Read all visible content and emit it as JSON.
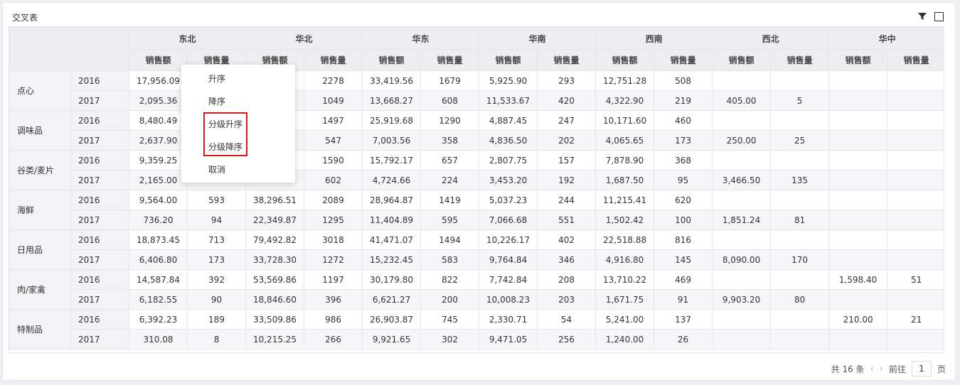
{
  "panel_title": "交叉表",
  "icons": {
    "filter": "filter-icon",
    "maximize": "square-icon"
  },
  "regions": [
    "东北",
    "华北",
    "华东",
    "华南",
    "西南",
    "西北",
    "华中"
  ],
  "measures": {
    "amount": "销售额",
    "qty": "销售量"
  },
  "rows": [
    {
      "product": "点心",
      "years": [
        {
          "year": "2016",
          "cells": [
            "17,956.09",
            "",
            "",
            "2278",
            "33,419.56",
            "1679",
            "5,925.90",
            "293",
            "12,751.28",
            "508",
            "",
            "",
            "",
            ""
          ]
        },
        {
          "year": "2017",
          "cells": [
            "2,095.36",
            "",
            "",
            "1049",
            "13,668.27",
            "608",
            "11,533.67",
            "420",
            "4,322.90",
            "219",
            "405.00",
            "5",
            "",
            ""
          ]
        }
      ]
    },
    {
      "product": "调味品",
      "years": [
        {
          "year": "2016",
          "cells": [
            "8,480.49",
            "",
            "",
            "1497",
            "25,919.68",
            "1290",
            "4,887.45",
            "247",
            "10,171.60",
            "460",
            "",
            "",
            "",
            ""
          ]
        },
        {
          "year": "2017",
          "cells": [
            "2,637.90",
            "",
            "",
            "547",
            "7,003.56",
            "358",
            "4,836.50",
            "202",
            "4,065.65",
            "173",
            "250.00",
            "25",
            "",
            ""
          ]
        }
      ]
    },
    {
      "product": "谷类/麦片",
      "years": [
        {
          "year": "2016",
          "cells": [
            "9,359.25",
            "",
            "",
            "1590",
            "15,792.17",
            "657",
            "2,807.75",
            "157",
            "7,878.90",
            "368",
            "",
            "",
            "",
            ""
          ]
        },
        {
          "year": "2017",
          "cells": [
            "2,165.00",
            "",
            "",
            "602",
            "4,724.66",
            "224",
            "3,453.20",
            "192",
            "1,687.50",
            "95",
            "3,466.50",
            "135",
            "",
            ""
          ]
        }
      ]
    },
    {
      "product": "海鲜",
      "years": [
        {
          "year": "2016",
          "cells": [
            "9,564.00",
            "593",
            "38,296.51",
            "2089",
            "28,964.87",
            "1419",
            "5,037.23",
            "244",
            "11,215.41",
            "620",
            "",
            "",
            "",
            ""
          ]
        },
        {
          "year": "2017",
          "cells": [
            "736.20",
            "94",
            "22,349.87",
            "1295",
            "11,404.89",
            "595",
            "7,066.68",
            "551",
            "1,502.42",
            "100",
            "1,851.24",
            "81",
            "",
            ""
          ]
        }
      ]
    },
    {
      "product": "日用品",
      "years": [
        {
          "year": "2016",
          "cells": [
            "18,873.45",
            "713",
            "79,492.82",
            "3018",
            "41,471.07",
            "1494",
            "10,226.17",
            "402",
            "22,518.88",
            "816",
            "",
            "",
            "",
            ""
          ]
        },
        {
          "year": "2017",
          "cells": [
            "6,406.80",
            "173",
            "33,728.30",
            "1272",
            "15,232.45",
            "583",
            "9,764.84",
            "346",
            "4,916.80",
            "145",
            "8,090.00",
            "170",
            "",
            ""
          ]
        }
      ]
    },
    {
      "product": "肉/家禽",
      "years": [
        {
          "year": "2016",
          "cells": [
            "14,587.84",
            "392",
            "53,569.86",
            "1197",
            "30,179.80",
            "822",
            "7,742.84",
            "208",
            "13,710.22",
            "469",
            "",
            "",
            "1,598.40",
            "51"
          ]
        },
        {
          "year": "2017",
          "cells": [
            "6,182.55",
            "90",
            "18,846.60",
            "396",
            "6,621.27",
            "200",
            "10,008.23",
            "203",
            "1,671.75",
            "91",
            "9,903.20",
            "80",
            "",
            ""
          ]
        }
      ]
    },
    {
      "product": "特制品",
      "years": [
        {
          "year": "2016",
          "cells": [
            "6,392.23",
            "189",
            "33,509.86",
            "986",
            "26,903.87",
            "745",
            "2,330.71",
            "54",
            "5,241.00",
            "137",
            "",
            "",
            "210.00",
            "21"
          ]
        },
        {
          "year": "2017",
          "cells": [
            "310.08",
            "8",
            "10,215.25",
            "266",
            "9,921.65",
            "302",
            "9,471.05",
            "256",
            "1,240.00",
            "26",
            "",
            "",
            "",
            ""
          ]
        }
      ]
    }
  ],
  "context_menu": {
    "asc": "升序",
    "desc": "降序",
    "level_asc": "分级升序",
    "level_desc": "分级降序",
    "cancel": "取消"
  },
  "highlight_color": "#d7191c",
  "pagination": {
    "total": "共 16 条",
    "prev_icon": "chevron-left-icon",
    "next_icon": "chevron-right-icon",
    "goto_label": "前往",
    "page_value": "1",
    "page_suffix": "页"
  }
}
